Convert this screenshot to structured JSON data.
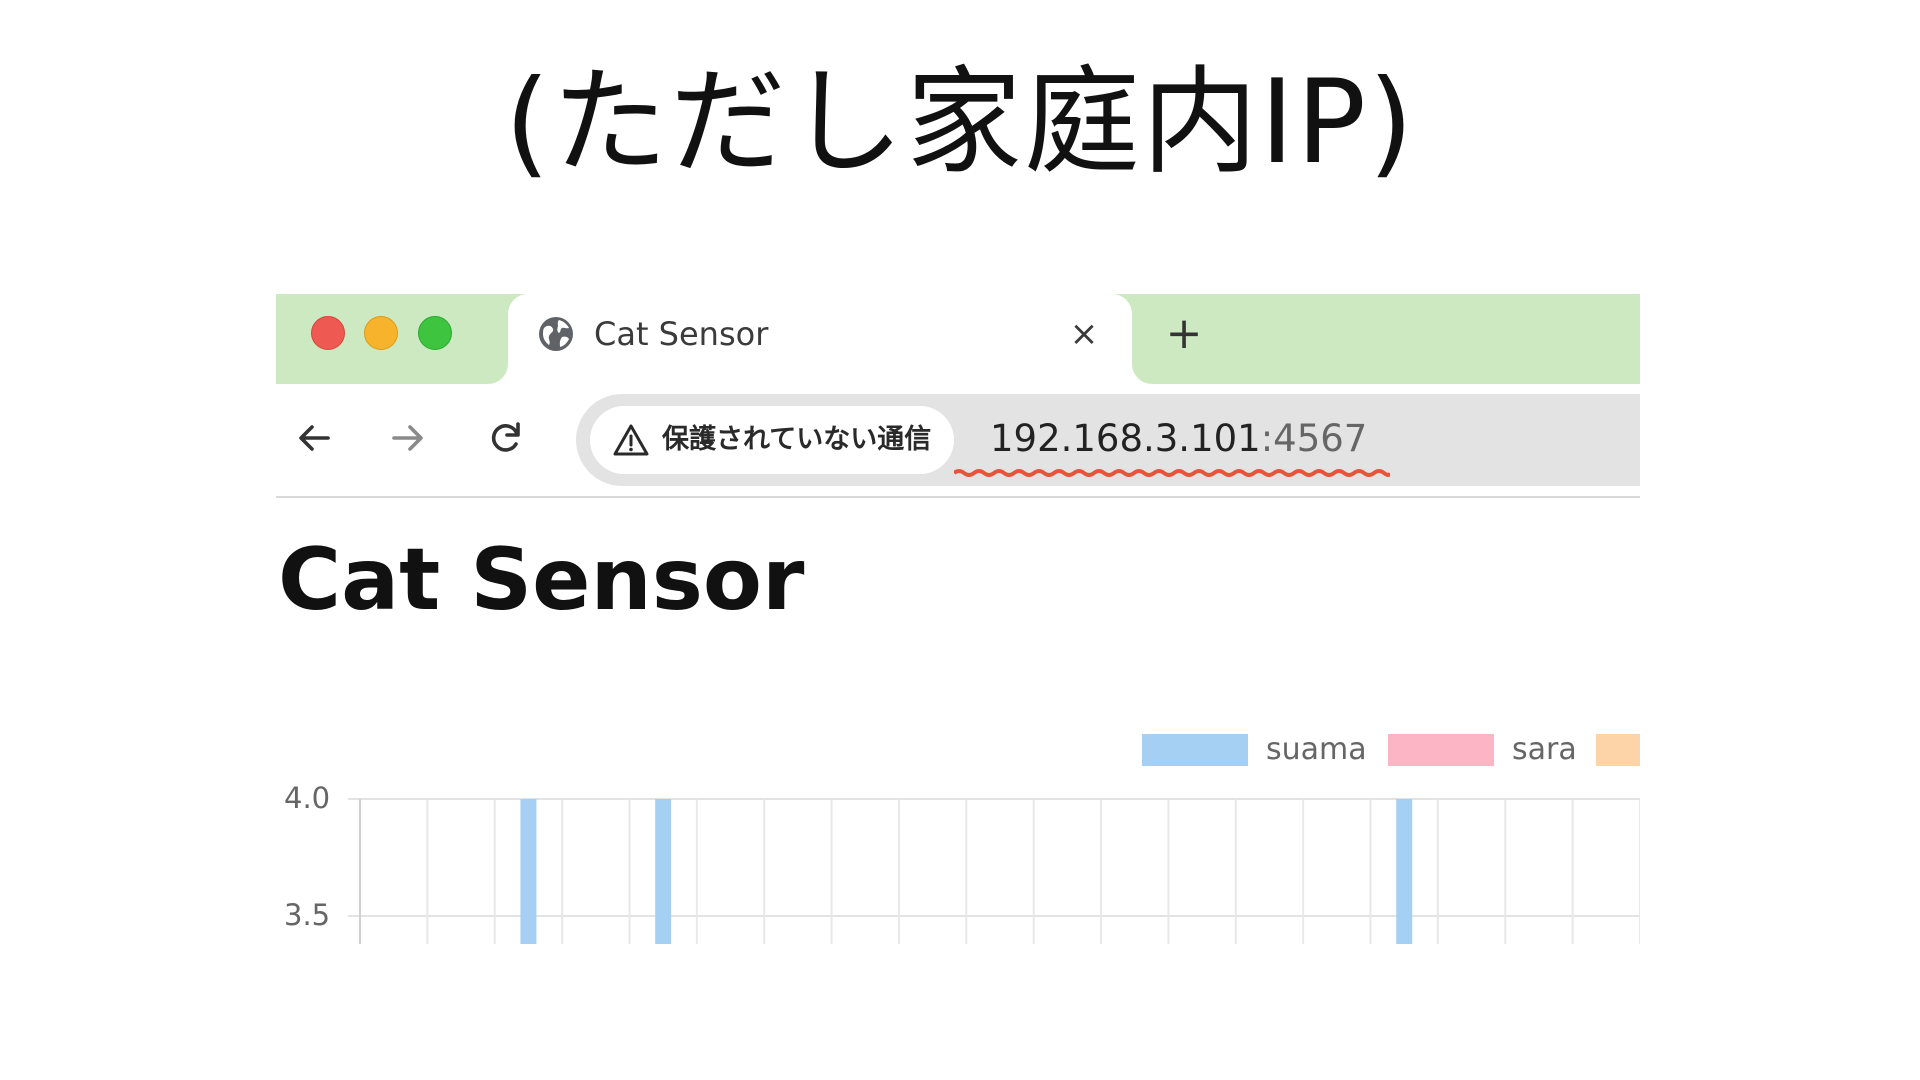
{
  "slide": {
    "title": "(ただし家庭内IP)"
  },
  "browser": {
    "tab": {
      "title": "Cat Sensor",
      "close_glyph": "×",
      "icon": "globe-icon"
    },
    "new_tab_glyph": "+",
    "nav": {
      "back_icon": "arrow-left-icon",
      "forward_icon": "arrow-right-icon",
      "reload_icon": "reload-icon"
    },
    "address_bar": {
      "security_label": "保護されていない通信",
      "security_icon": "warning-triangle-icon",
      "url_host": "192.168.3.101",
      "url_port": ":4567"
    },
    "colors": {
      "tabbar": "#cde9c1",
      "underline": "#e8543a"
    }
  },
  "page": {
    "heading": "Cat Sensor"
  },
  "chart_data": {
    "type": "bar",
    "legend_position": "top-right",
    "grid": true,
    "series": [
      {
        "name": "suama",
        "color": "#a6d0f3"
      },
      {
        "name": "sara",
        "color": "#fbb5c5"
      },
      {
        "name": "",
        "color": "#fdd3a8"
      }
    ],
    "y_ticks": [
      "4.0",
      "3.5"
    ],
    "visible_bars": [
      {
        "series": "suama",
        "slot": 2,
        "value_at_least": 4.0
      },
      {
        "series": "suama",
        "slot": 4,
        "value_at_least": 4.0
      },
      {
        "series": "suama",
        "slot": 15,
        "value_at_least": 4.0
      }
    ],
    "slot_count": 19
  }
}
